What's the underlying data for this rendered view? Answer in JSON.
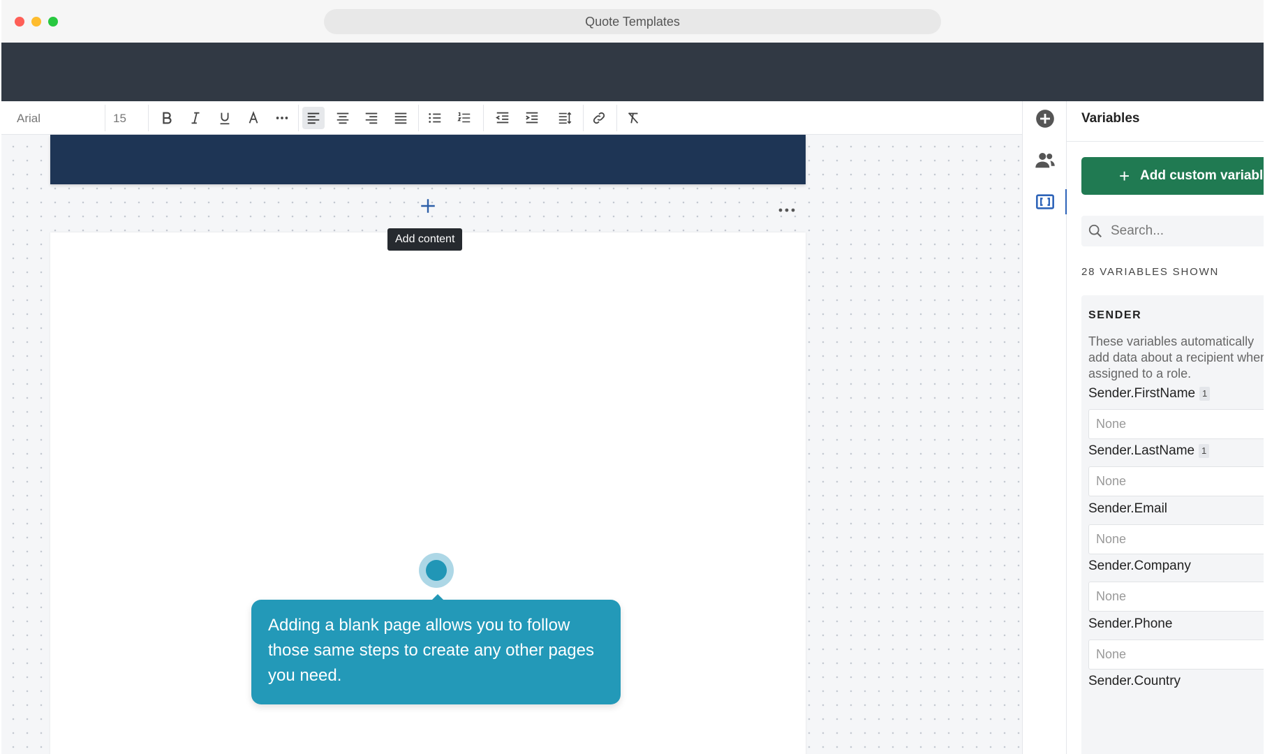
{
  "window": {
    "url_title": "Quote Templates"
  },
  "toolbar": {
    "font": "Arial",
    "size": "15",
    "buttons": [
      "bold-icon",
      "italic-icon",
      "underline-icon",
      "font-color-icon",
      "more-icon",
      "align-left-icon",
      "align-center-icon",
      "align-right-icon",
      "justify-icon",
      "bullet-list-icon",
      "numbered-list-icon",
      "outdent-icon",
      "indent-icon",
      "line-height-icon",
      "link-icon",
      "clear-format-icon"
    ]
  },
  "canvas": {
    "tooltip": "Add content",
    "callout": "Adding a blank page allows you to follow those same steps to create any other pages you need."
  },
  "rail": {
    "icons": [
      "add-circle-icon",
      "people-icon",
      "variables-icon"
    ]
  },
  "panel": {
    "title": "Variables",
    "add_button": "Add custom variable",
    "search_placeholder": "Search...",
    "count_label": "28 VARIABLES SHOWN",
    "group": {
      "title": "SENDER",
      "description": "These variables automatically add data about a recipient when assigned to a role.",
      "items": [
        {
          "name": "Sender.FirstName",
          "badge": "1",
          "value": "None"
        },
        {
          "name": "Sender.LastName",
          "badge": "1",
          "value": "None"
        },
        {
          "name": "Sender.Email",
          "badge": "",
          "value": "None"
        },
        {
          "name": "Sender.Company",
          "badge": "",
          "value": "None"
        },
        {
          "name": "Sender.Phone",
          "badge": "",
          "value": "None"
        },
        {
          "name": "Sender.Country",
          "badge": "",
          "value": ""
        }
      ]
    }
  },
  "colors": {
    "header": "#313944",
    "page_header": "#1e3555",
    "callout": "#2399b8",
    "primary_button": "#207a52",
    "accent": "#2d63b8"
  }
}
